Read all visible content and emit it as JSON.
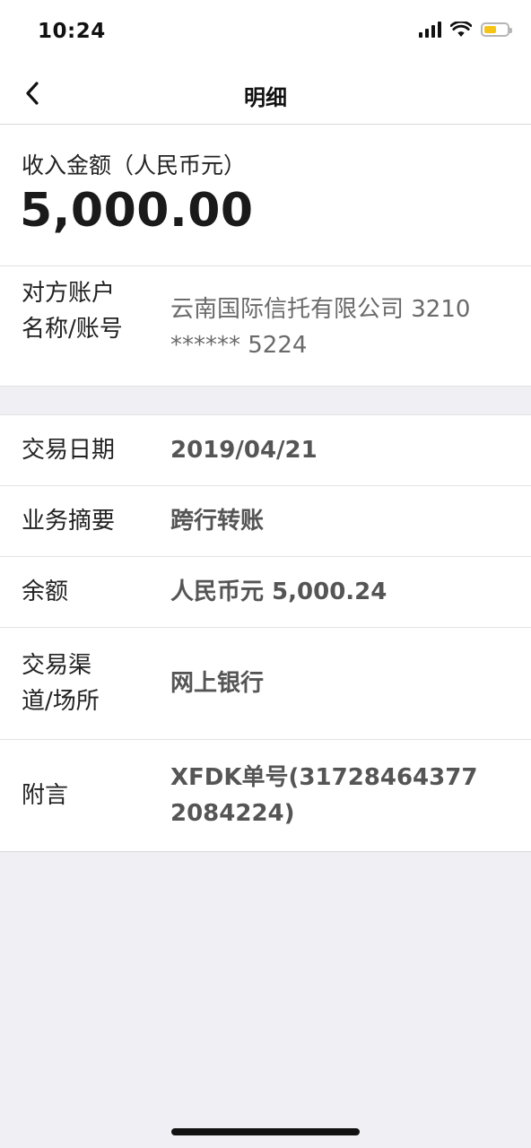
{
  "status_bar": {
    "time": "10:24",
    "icons": [
      "signal-icon",
      "wifi-icon",
      "battery-icon"
    ],
    "battery_level_percent": 55,
    "battery_color": "#f5c416"
  },
  "nav": {
    "back_icon": "chevron-left-icon",
    "title": "明细"
  },
  "amount": {
    "label": "收入金额（人民币元）",
    "value": "5,000.00"
  },
  "counterparty": {
    "label": "对方账户名称/账号",
    "value": "云南国际信托有限公司 3210 ****** 5224"
  },
  "details": [
    {
      "label": "交易日期",
      "value": "2019/04/21"
    },
    {
      "label": "业务摘要",
      "value": "跨行转账"
    },
    {
      "label": "余额",
      "value": "人民币元 5,000.24"
    },
    {
      "label": "交易渠道/场所",
      "value": "网上银行"
    },
    {
      "label": "附言",
      "value": "XFDK单号(317284643772084224)"
    }
  ]
}
